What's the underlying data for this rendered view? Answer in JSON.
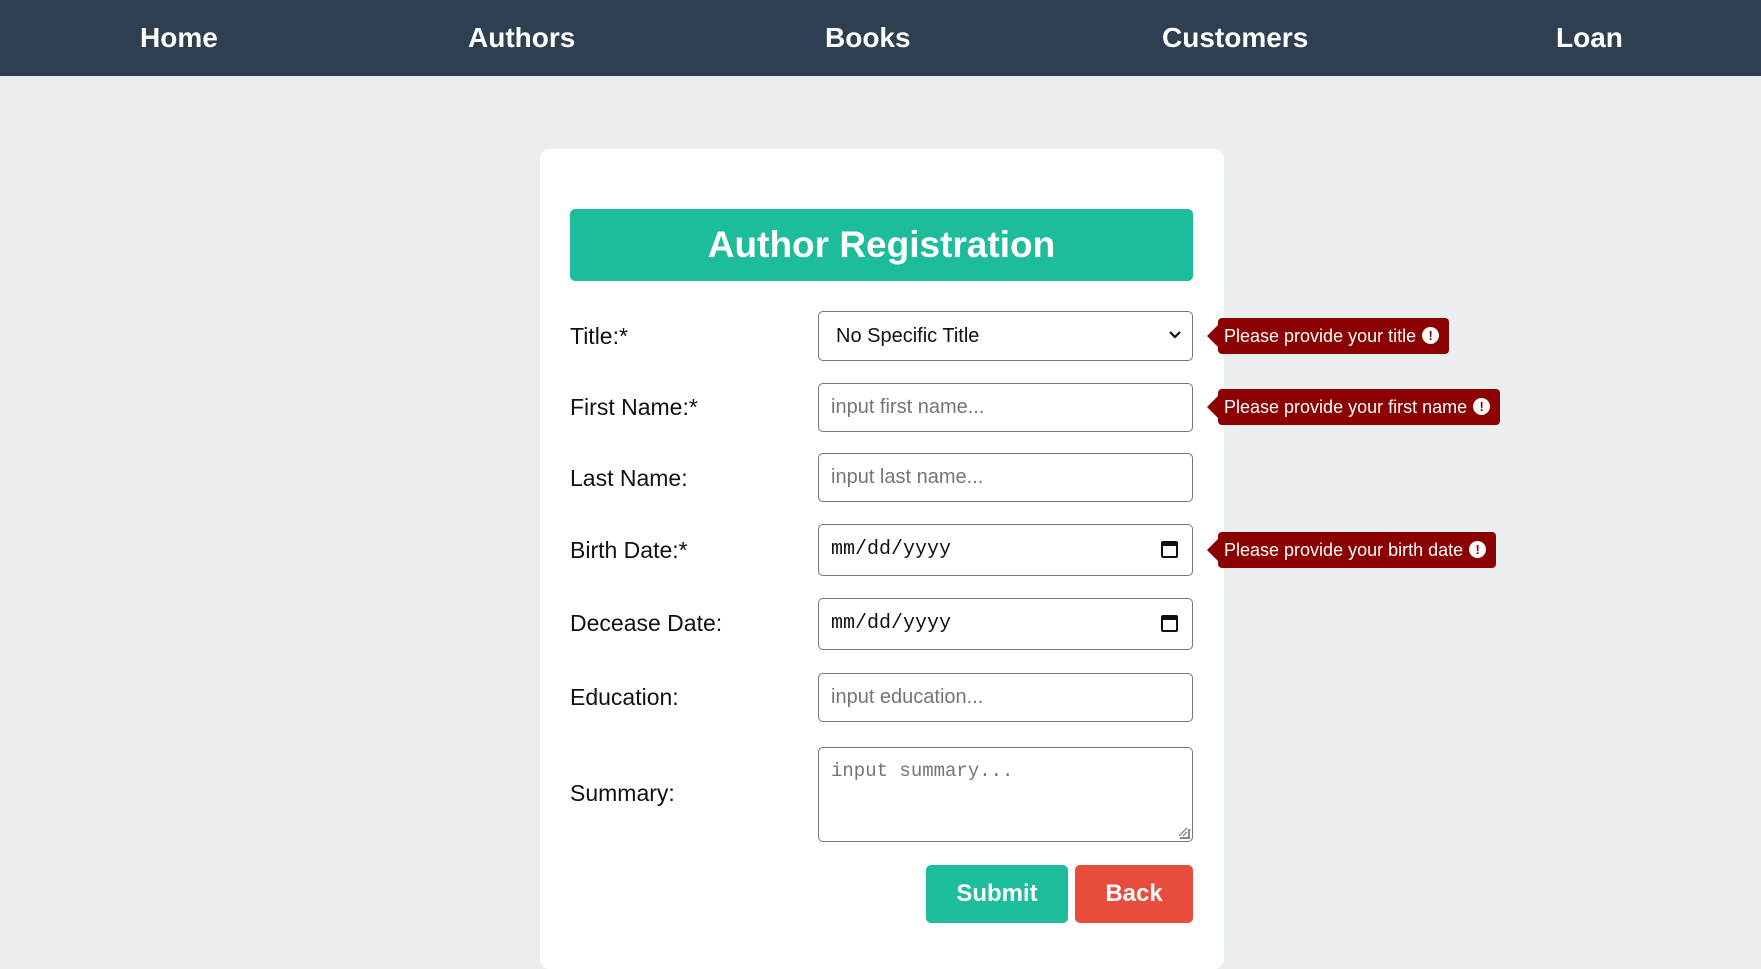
{
  "nav": {
    "home": "Home",
    "authors": "Authors",
    "books": "Books",
    "customers": "Customers",
    "loan": "Loan"
  },
  "form": {
    "title": "Author Registration",
    "fields": {
      "title": {
        "label": "Title:*",
        "value": "No Specific Title",
        "error": "Please provide your title"
      },
      "first_name": {
        "label": "First Name:*",
        "placeholder": "input first name...",
        "error": "Please provide your first name"
      },
      "last_name": {
        "label": "Last Name:",
        "placeholder": "input last name..."
      },
      "birth_date": {
        "label": "Birth Date:*",
        "placeholder": "mm/dd/yyyy",
        "error": "Please provide your birth date"
      },
      "decease_date": {
        "label": "Decease Date:",
        "placeholder": "mm/dd/yyyy"
      },
      "education": {
        "label": "Education:",
        "placeholder": "input education..."
      },
      "summary": {
        "label": "Summary:",
        "placeholder": "input summary..."
      }
    },
    "buttons": {
      "submit": "Submit",
      "back": "Back"
    }
  },
  "colors": {
    "navbar": "#2f3e50",
    "accent": "#1dbc9b",
    "danger": "#e74c3c",
    "error_tooltip": "#8b0000",
    "page_background": "#ebeeef"
  },
  "icons": {
    "select": "chevron-down-icon",
    "date": "calendar-icon",
    "error": "exclamation-circle-icon"
  }
}
